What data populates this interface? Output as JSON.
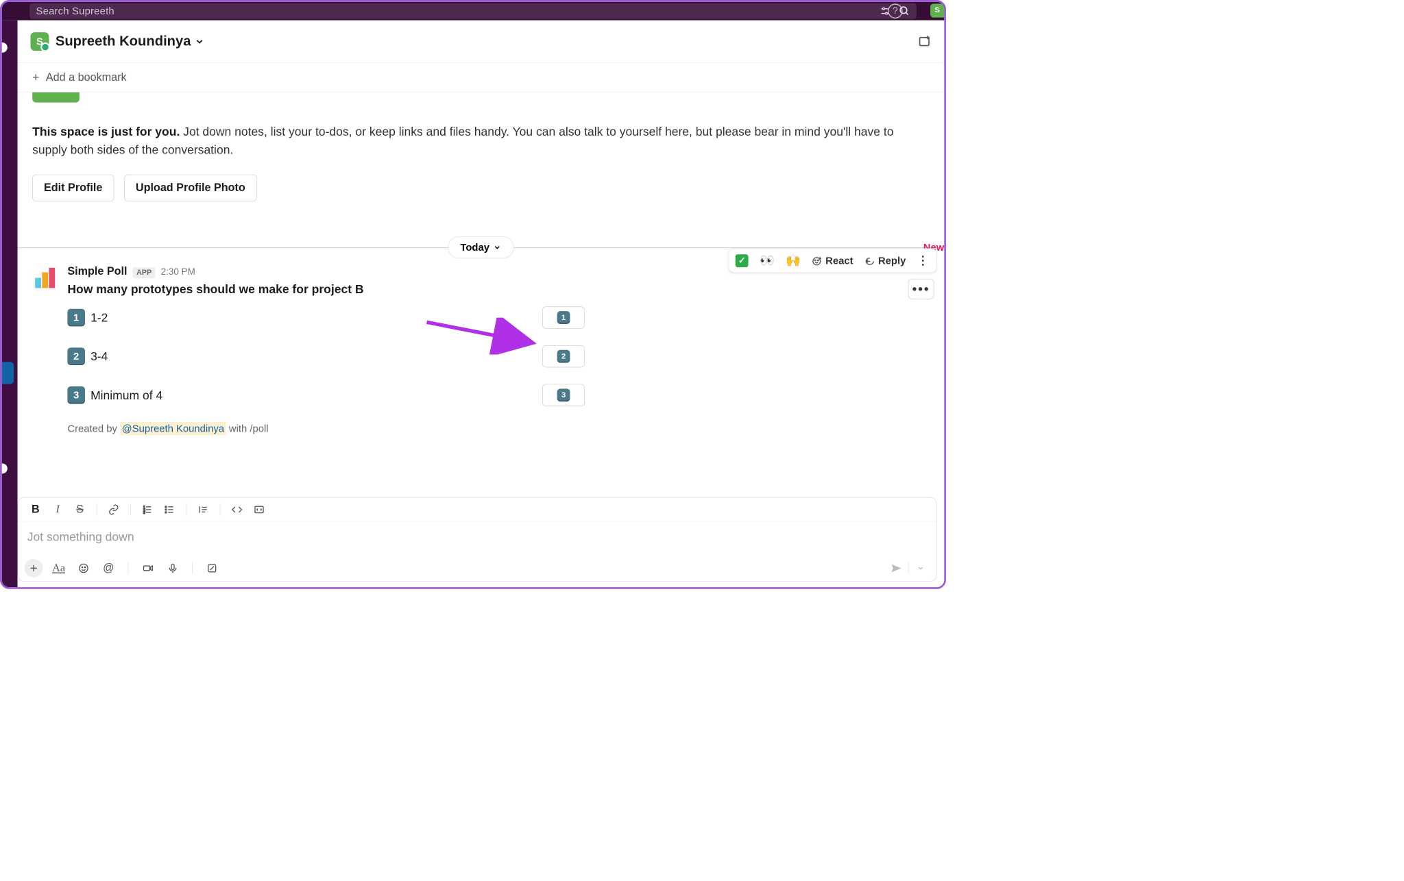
{
  "search": {
    "placeholder": "Search Supreeth"
  },
  "header": {
    "channel_name": "Supreeth Koundinya",
    "avatar_letter": "S"
  },
  "bookmark": {
    "add_label": "Add a bookmark"
  },
  "intro": {
    "bold": "This space is just for you.",
    "rest": " Jot down notes, list your to-dos, or keep links and files handy. You can also talk to yourself here, but please bear in mind you'll have to supply both sides of the conversation.",
    "edit_profile": "Edit Profile",
    "upload_photo": "Upload Profile Photo"
  },
  "divider": {
    "date": "Today",
    "new_label": "New"
  },
  "actions": {
    "react": "React",
    "reply": "Reply"
  },
  "message": {
    "sender": "Simple Poll",
    "badge": "APP",
    "time": "2:30 PM",
    "question": "How many prototypes should we make for project B",
    "options": [
      {
        "num": "1",
        "label": "1-2"
      },
      {
        "num": "2",
        "label": "3-4"
      },
      {
        "num": "3",
        "label": "Minimum of 4"
      }
    ],
    "created_prefix": "Created by ",
    "created_mention": "@Supreeth Koundinya",
    "created_suffix": " with /poll"
  },
  "composer": {
    "placeholder": "Jot something down"
  },
  "green_chip_letter": "S"
}
